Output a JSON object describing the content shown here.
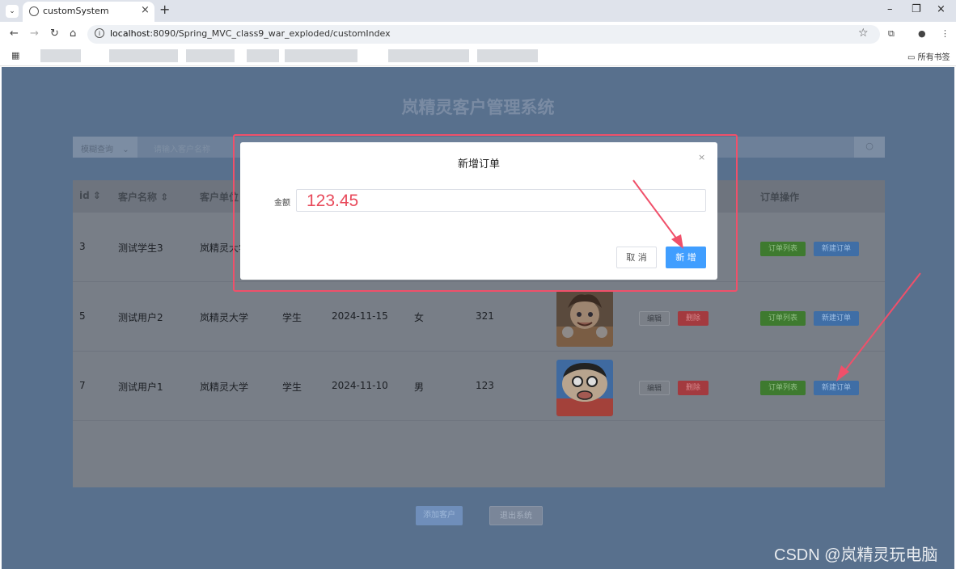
{
  "browser": {
    "tab_title": "customSystem",
    "tab_close": "×",
    "new_tab": "+",
    "url_host": "localhost",
    "url_rest": ":8090/Spring_MVC_class9_war_exploded/customIndex",
    "bookmarks_all": "所有书签",
    "window_controls": [
      "–",
      "❐",
      "×"
    ]
  },
  "app": {
    "title": "岚精灵客户管理系统",
    "search": {
      "mode": "模糊查询",
      "placeholder": "请输入客户名称",
      "button_icon": "search-icon"
    },
    "table": {
      "headers": [
        "id",
        "客户名称",
        "客户单位",
        "订单操作"
      ],
      "rows": [
        {
          "id": "3",
          "name": "测试学生3",
          "unit": "岚精灵大学",
          "role": "",
          "date": "",
          "gender": "",
          "amount": "",
          "has_avatar": false
        },
        {
          "id": "5",
          "name": "测试用户2",
          "unit": "岚精灵大学",
          "role": "学生",
          "date": "2024-11-15",
          "gender": "女",
          "amount": "321",
          "has_avatar": true
        },
        {
          "id": "7",
          "name": "测试用户1",
          "unit": "岚精灵大学",
          "role": "学生",
          "date": "2024-11-10",
          "gender": "男",
          "amount": "123",
          "has_avatar": true
        }
      ],
      "edit_label": "编辑",
      "delete_label": "删除",
      "orders_label": "订单列表",
      "new_order_label": "新建订单"
    },
    "footer": {
      "add_customer": "添加客户",
      "exit": "退出系统"
    }
  },
  "modal": {
    "title": "新增订单",
    "close_icon": "×",
    "field_label": "金额",
    "field_value": "123.45",
    "cancel_label": "取 消",
    "confirm_label": "新 增"
  },
  "watermark": "CSDN @岚精灵玩电脑",
  "colors": {
    "accent": "#409eff",
    "annotation": "#f0506a",
    "overlay_bg": "#58708d"
  }
}
